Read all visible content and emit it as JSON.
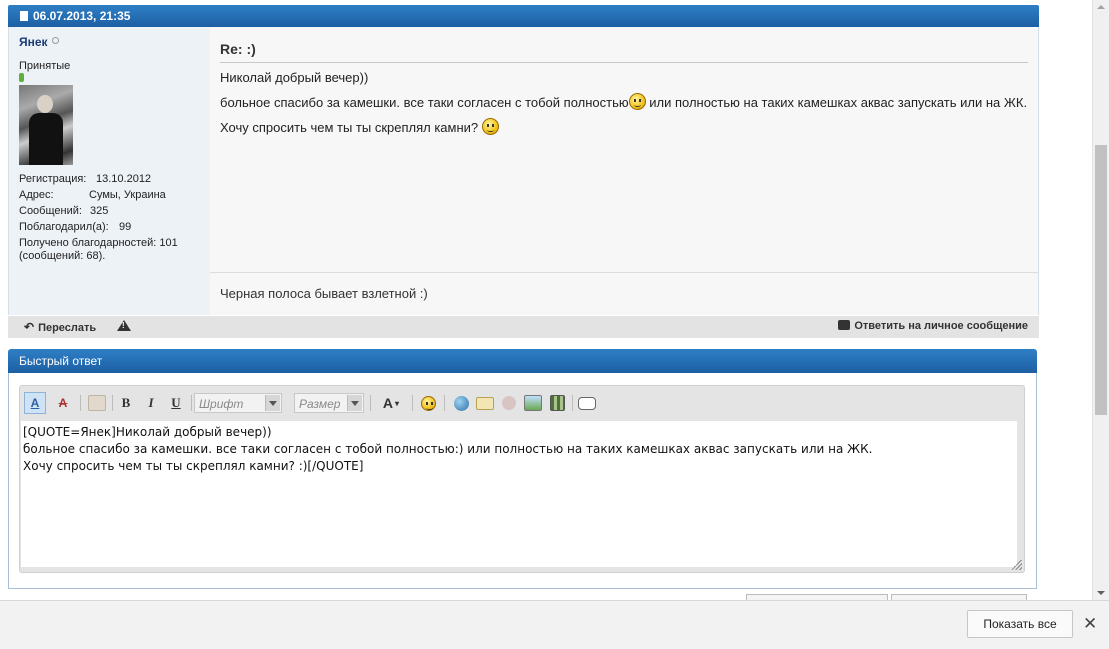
{
  "post": {
    "date": "06.07.2013, 21:35",
    "user": {
      "name": "Янек",
      "title": "Принятые",
      "stats": [
        {
          "key": "Регистрация:",
          "value": "13.10.2012"
        },
        {
          "key": "Адрес:",
          "value": "Сумы, Украина"
        },
        {
          "key": "Сообщений:",
          "value": "325"
        },
        {
          "key": "Поблагодарил(а):",
          "value": "99"
        }
      ],
      "thanks_line1": "Получено благодарностей: 101",
      "thanks_line2": "(сообщений: 68)."
    },
    "title": "Re: :)",
    "lines": {
      "l1": "Николай добрый вечер))",
      "l2a": "больное спасибо за камешки. все таки согласен с тобой полностью",
      "l2b": " или полностью на таких камешках аквас запускать или на ЖК.",
      "l3": "Хочу спросить чем ты ты скреплял камни? "
    },
    "signature": "Черная полоса бывает взлетной :)",
    "forward_label": "Переслать",
    "pm_label": "Ответить на личное сообщение"
  },
  "quick_reply": {
    "title": "Быстрый ответ",
    "font_placeholder": "Шрифт",
    "size_placeholder": "Размер",
    "text": "[QUOTE=Янек]Николай добрый вечер))\nбольное спасибо за камешки. все таки согласен с тобой полностью:) или полностью на таких камешках аквас запускать или на ЖК.\nХочу спросить чем ты ты скреплял камни? :)[/QUOTE]"
  },
  "toolbar_icons": [
    "remove-format-icon",
    "switch-mode-icon",
    "paste-icon",
    "bold-icon",
    "italic-icon",
    "underline-icon",
    "text-color-icon",
    "smiley-icon",
    "link-icon",
    "email-icon",
    "unlink-icon",
    "image-icon",
    "video-icon",
    "quote-icon"
  ],
  "download_bar": {
    "show_all_label": "Показать все",
    "close_glyph": "✕"
  },
  "colors": {
    "header_blue": "#1d5fa3",
    "user_panel": "#edf2f7",
    "message_bg": "#f7f7f7"
  }
}
